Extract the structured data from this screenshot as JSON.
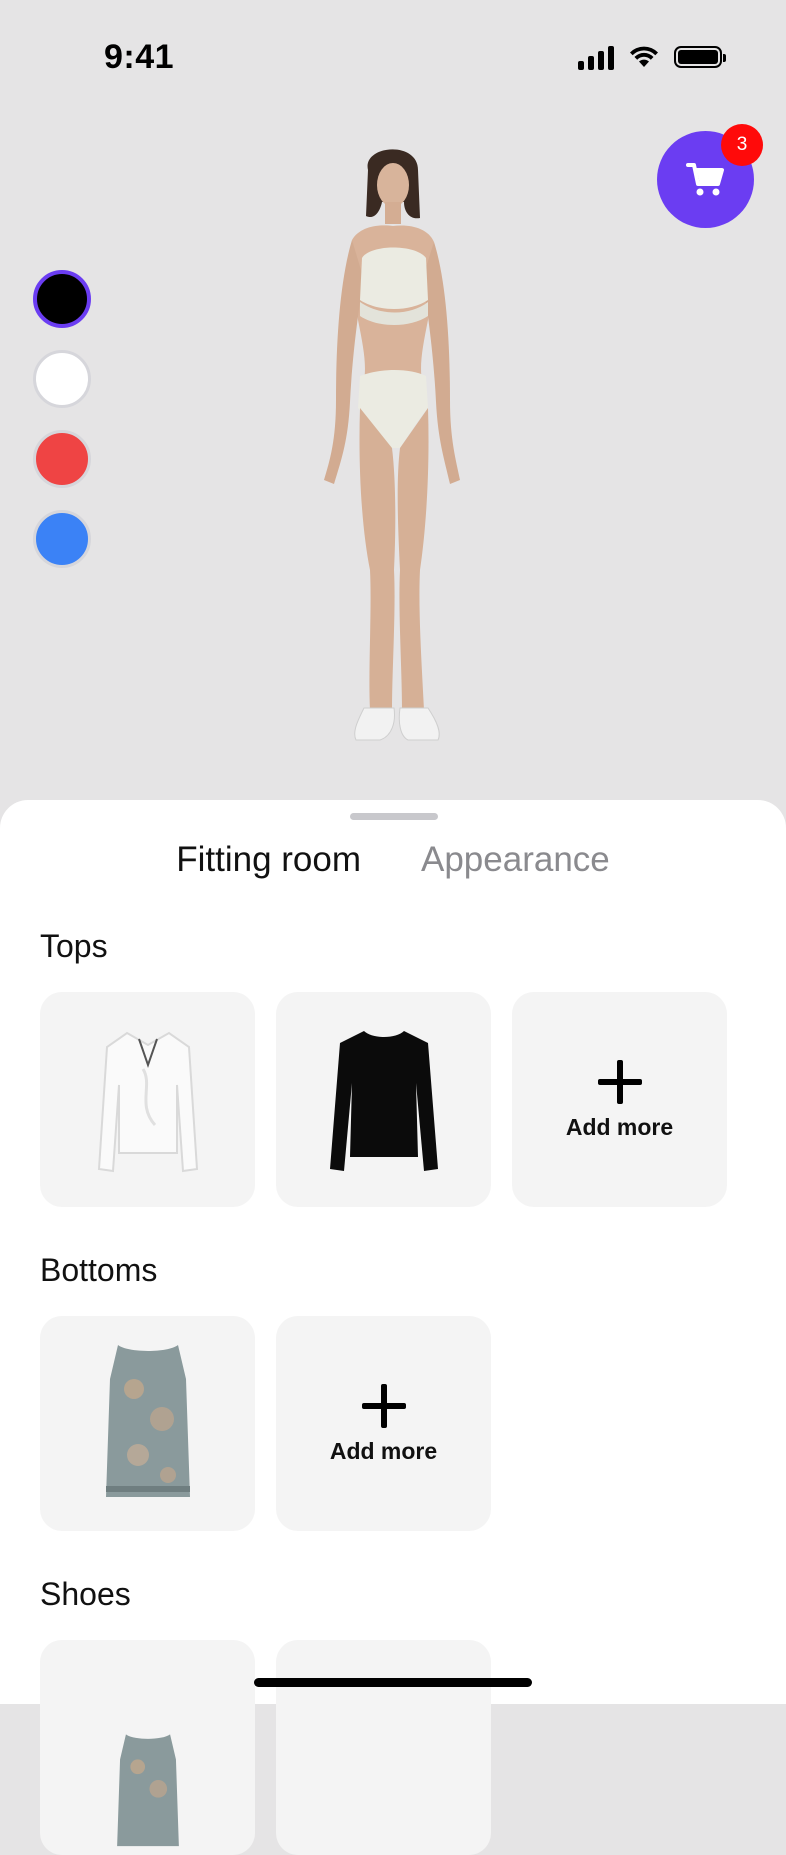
{
  "status_bar": {
    "time": "9:41"
  },
  "cart": {
    "badge_count": "3",
    "accent_color": "#6b3df2",
    "badge_color": "#ff0a0a",
    "icon": "cart-icon"
  },
  "color_swatches": [
    {
      "name": "black",
      "color": "#000000",
      "selected": true
    },
    {
      "name": "white",
      "color": "#ffffff",
      "selected": false
    },
    {
      "name": "red",
      "color": "#ef4444",
      "selected": false
    },
    {
      "name": "blue",
      "color": "#3b82f6",
      "selected": false
    }
  ],
  "tabs": {
    "fitting_room": "Fitting room",
    "appearance": "Appearance",
    "active": "fitting_room"
  },
  "sections": {
    "tops": {
      "title": "Tops",
      "items": [
        "white blouse",
        "black long-sleeve top"
      ],
      "add_label": "Add more"
    },
    "bottoms": {
      "title": "Bottoms",
      "items": [
        "patterned sleeveless top"
      ],
      "add_label": "Add more"
    },
    "shoes": {
      "title": "Shoes",
      "items": [
        "patterned sleeveless top"
      ]
    }
  }
}
